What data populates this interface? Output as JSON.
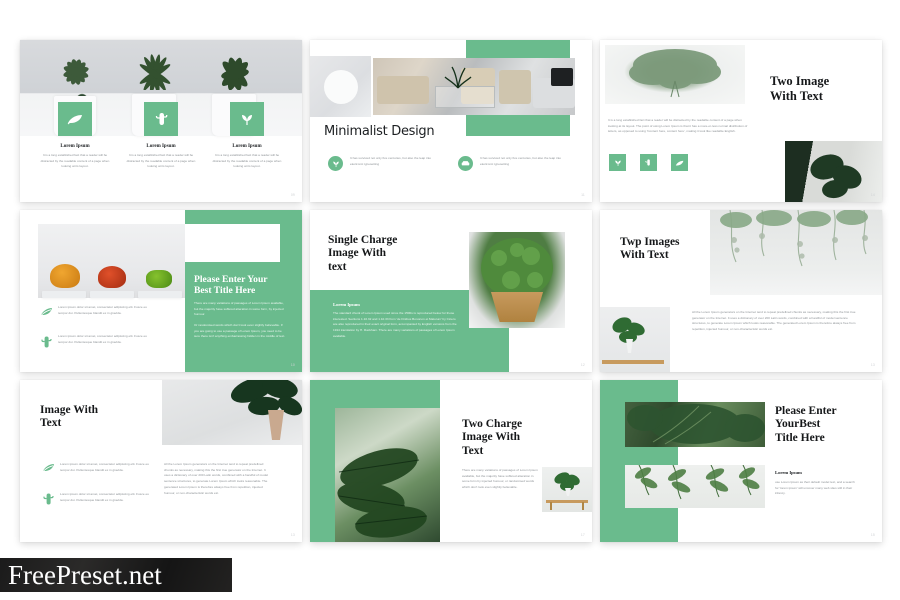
{
  "meta": {
    "accent_green": "#6ABB8D",
    "background": "#ffffff",
    "watermark": "FreePreset.net"
  },
  "lorem": {
    "short": "It is a long established fact that a reader will be distracted by the readable content of a page when looking at its layout.",
    "centuries": "It has survived not only five centuries, but also the leap into electronic typesetting",
    "bullet": "Lorem ipsum dolor sit amet, consectetur adipiscing elit. Fusce eu tempor dui. Pellentesque blandit ex in gravida.",
    "variations": "There are many variations of passages of Lorem Ipsum available, but the majority have suffered alteration in some form, by injected humour.",
    "randomised": "Or randomised words which don't look even slightly believable. If you are going to use a passage of Lorem Ipsum, you need to be sure there isn't anything embarrassing hidden in the middle of text.",
    "standard": "The standard chunk of Lorem Ipsum used since the 1500s is reproduced below for those interested. Sections 1.10.32 and 1.10.33 from 'de Finibus Bonorum et Malorum' by Cicero are also reproduced in their exact original form, accompanied by English versions from the 1914 translation by H. Rackham. There are many variations of passages of Lorem Ipsum available.",
    "generators": "All the Lorem Ipsum generators on the Internet tend to repeat predefined chunks as necessary, making this the first true generator on the Internet. It uses a dictionary of over 200 Latin words, combined with a handful of model sentence structures, to generate Lorem Ipsum which looks reasonable. The generated Lorem Ipsum is therefore always free from repetition, injected humour, or non-characteristic words etc.",
    "twoimage": "It is a long established fact that a reader will be distracted by the readable content of a page when looking at its layout. The point of using Lorem Ipsum is that it has a more-or-less normal distribution of letters, as opposed to using 'Content here, content here', making it look like readable English.",
    "variations_short": "There are many variations of passages of Lorem Ipsum available, but the majority have suffered alteration in some form by injected humour, or randomised words which don't look even slightly believable.",
    "default": "use Lorem Ipsum as their default model text, and a search for 'lorem ipsum' will uncover many web sites still in their infancy."
  },
  "slides": [
    {
      "id": "slide-1",
      "name": "three-feature-icons",
      "page": "09",
      "cards": [
        {
          "title": "Lorem Ipsum",
          "icon": "leaf-icon",
          "body": "It is a long established fact that a reader will be distracted by the readable content of a page when looking at its layout."
        },
        {
          "title": "Lorem Ipsum",
          "icon": "cactus-icon",
          "body": "It is a long established fact that a reader will be distracted by the readable content of a page when looking at its layout."
        },
        {
          "title": "Lorem Ipsum",
          "icon": "plant-icon",
          "body": "It is a long established fact that a reader will be distracted by the readable content of a page when looking at its layout."
        }
      ]
    },
    {
      "id": "slide-2",
      "name": "minimalist-design",
      "page": "11",
      "title": "Minimalist Design",
      "features": [
        {
          "icon": "plant-circle-icon",
          "body": "It has survived not only five centuries, but also the leap into electronic typesetting"
        },
        {
          "icon": "sofa-circle-icon",
          "body": "It has survived not only five centuries, but also the leap into electronic typesetting"
        }
      ]
    },
    {
      "id": "slide-3",
      "name": "two-image-with-text",
      "page": "14",
      "title_line1": "Two Image",
      "title_line2": "With Text",
      "body": "It is a long established fact that a reader will be distracted by the readable content of a page when looking at its layout. The point of using Lorem Ipsum is that it has a more-or-less normal distribution of letters, as opposed to using 'Content here, content here', making it look like readable English.",
      "icons": [
        "plant-icon",
        "cactus-icon",
        "leaf-icon"
      ]
    },
    {
      "id": "slide-4",
      "name": "please-enter-your-best-title-here",
      "page": "10",
      "title_line1": "Please Enter Your",
      "title_line2": "Best Title Here",
      "para1": "There are many variations of passages of Lorem Ipsum available, but the majority have suffered alteration in some form, by injected humour.",
      "para2": "Or randomised words which don't look even slightly believable. If you are going to use a passage of Lorem Ipsum, you need to be sure there isn't anything embarrassing hidden in the middle of text.",
      "bullets": [
        {
          "icon": "leaf-icon",
          "body": "Lorem ipsum dolor sit amet, consectetur adipiscing elit. Fusce eu tempor dui. Pellentesque blandit ex in gravida."
        },
        {
          "icon": "cactus-icon",
          "body": "Lorem ipsum dolor sit amet, consectetur adipiscing elit. Fusce eu tempor dui. Pellentesque blandit ex in gravida."
        }
      ]
    },
    {
      "id": "slide-5",
      "name": "single-charge-image-with-text",
      "page": "12",
      "title_line1": "Single Charge",
      "title_line2": "Image With",
      "title_line3": "text",
      "subtitle": "Lorem Ipsum",
      "body": "The standard chunk of Lorem Ipsum used since the 1500s is reproduced below for those interested. Sections 1.10.32 and 1.10.33 from 'de Finibus Bonorum et Malorum' by Cicero are also reproduced in their exact original form, accompanied by English versions from the 1914 translation by H. Rackham. There are many variations of passages of Lorem Ipsum available."
    },
    {
      "id": "slide-6",
      "name": "twp-images-with-text",
      "page": "13",
      "title_line1": "Twp Images",
      "title_line2": "With Text",
      "body": "All the Lorem Ipsum generators on the Internet tend to repeat predefined chunks as necessary, making this the first true generator on the Internet. It uses a dictionary of over 200 Latin words, combined with a handful of model sentence structures, to generate Lorem Ipsum which looks reasonable. The generated Lorem Ipsum is therefore always free from repetition, injected humour, or non-characteristic words etc."
    },
    {
      "id": "slide-7",
      "name": "image-with-text",
      "page": "13",
      "title_line1": "Image With",
      "title_line2": "Text",
      "bullets": [
        {
          "icon": "leaf-icon",
          "body": "Lorem ipsum dolor sit amet, consectetur adipiscing elit. Fusce eu tempor dui. Pellentesque blandit ex in gravida."
        },
        {
          "icon": "cactus-icon",
          "body": "Lorem ipsum dolor sit amet, consectetur adipiscing elit. Fusce eu tempor dui. Pellentesque blandit ex in gravida."
        }
      ],
      "body": "All the Lorem Ipsum generators on the Internet tend to repeat predefined chunks as necessary, making this the first true generator on the Internet. It uses a dictionary of over 200 Latin words, combined with a handful of model sentence structures, to generate Lorem Ipsum which looks reasonable. The generated Lorem Ipsum is therefore always free from repetition, injected humour, or non-characteristic words etc."
    },
    {
      "id": "slide-8",
      "name": "two-charge-image-with-text",
      "page": "17",
      "title_line1": "Two Charge",
      "title_line2": "Image With",
      "title_line3": "Text",
      "body": "There are many variations of passages of Lorem Ipsum available, but the majority have suffered alteration in some form by injected humour, or randomised words which don't look even slightly believable."
    },
    {
      "id": "slide-9",
      "name": "please-enter-yourbest-title-here",
      "page": "15",
      "title_line1": "Please Enter",
      "title_line2": "YourBest",
      "title_line3": "Title Here",
      "subtitle": "Lorem Ipsum",
      "body": "use Lorem Ipsum as their default model text, and a search for 'lorem ipsum' will uncover many web sites still in their infancy."
    }
  ]
}
